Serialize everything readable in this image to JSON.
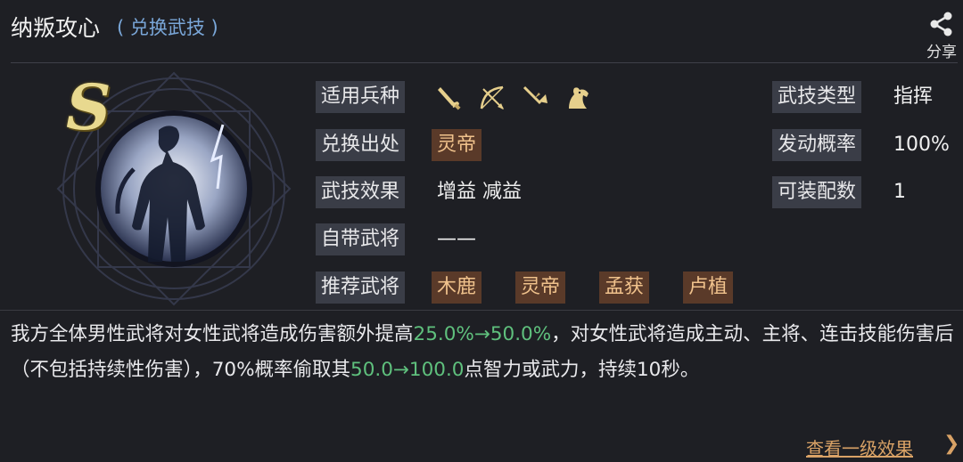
{
  "header": {
    "title": "纳叛攻心",
    "subtitle": "( 兑换武技 )",
    "share_label": "分享"
  },
  "grade": "S",
  "rows": {
    "unit_type_label": "适用兵种",
    "unit_icons": [
      "sword-icon",
      "bow-icon",
      "spear-icon",
      "horse-icon"
    ],
    "source_label": "兑换出处",
    "source_value": "灵帝",
    "effect_label": "武技效果",
    "effect_value": "增益 减益",
    "own_general_label": "自带武将",
    "own_general_value": "——",
    "recommend_label": "推荐武将",
    "recommend": [
      "木鹿",
      "灵帝",
      "孟获",
      "卢植"
    ],
    "skill_type_label": "武技类型",
    "skill_type_value": "指挥",
    "trigger_label": "发动概率",
    "trigger_value": "100%",
    "equip_label": "可装配数",
    "equip_value": "1"
  },
  "description": {
    "p1": "我方全体男性武将对女性武将造成伤害额外提高",
    "h1": "25.0%→50.0%",
    "p2": "，对女性武将造成主动、主将、连击技能伤害后（不包括持续性伤害），70%概率偷取其",
    "h2": "50.0→100.0",
    "p3": "点智力或武力，持续10秒。"
  },
  "footer": {
    "link_label": "查看一级效果",
    "chevron": "❯"
  },
  "colors": {
    "background": "#1e1f24",
    "label_bg": "#3a3d47",
    "tag_bg": "#5a3a29",
    "tag_text": "#f0c28c",
    "highlight": "#5fc07d",
    "link": "#d9a266",
    "subtitle": "#7aa7d9",
    "icon_gold": "#e6cf8c"
  }
}
